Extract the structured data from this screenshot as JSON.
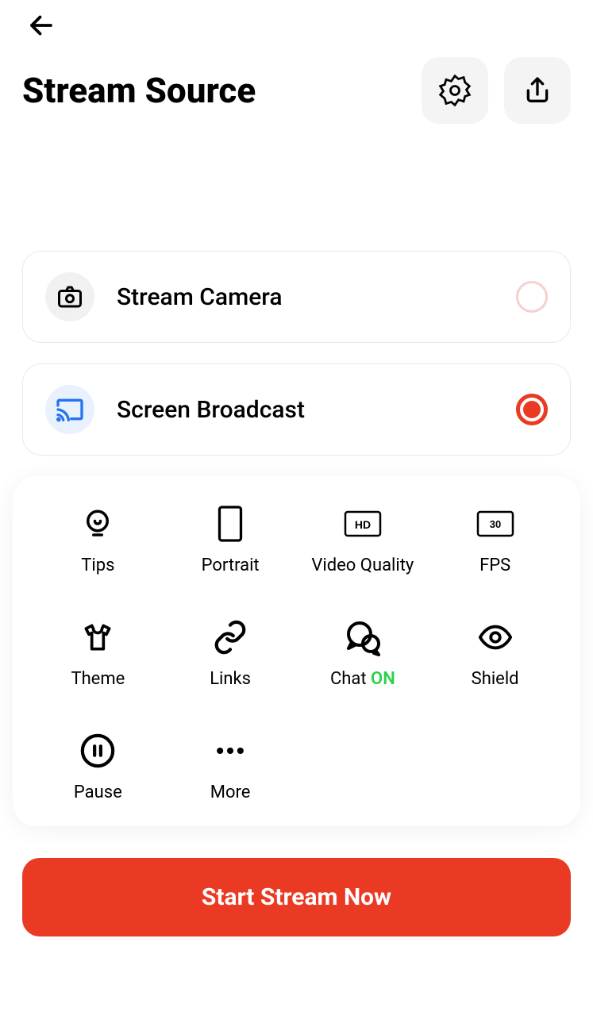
{
  "header": {
    "title": "Stream Source"
  },
  "sources": [
    {
      "label": "Stream Camera",
      "selected": false
    },
    {
      "label": "Screen Broadcast",
      "selected": true
    }
  ],
  "settings": {
    "tips": "Tips",
    "portrait": "Portrait",
    "video_quality": "Video Quality",
    "video_quality_value": "HD",
    "fps": "FPS",
    "fps_value": "30",
    "theme": "Theme",
    "links": "Links",
    "chat_label": "Chat",
    "chat_status": "ON",
    "shield": "Shield",
    "pause": "Pause",
    "more": "More"
  },
  "cta": "Start Stream Now"
}
